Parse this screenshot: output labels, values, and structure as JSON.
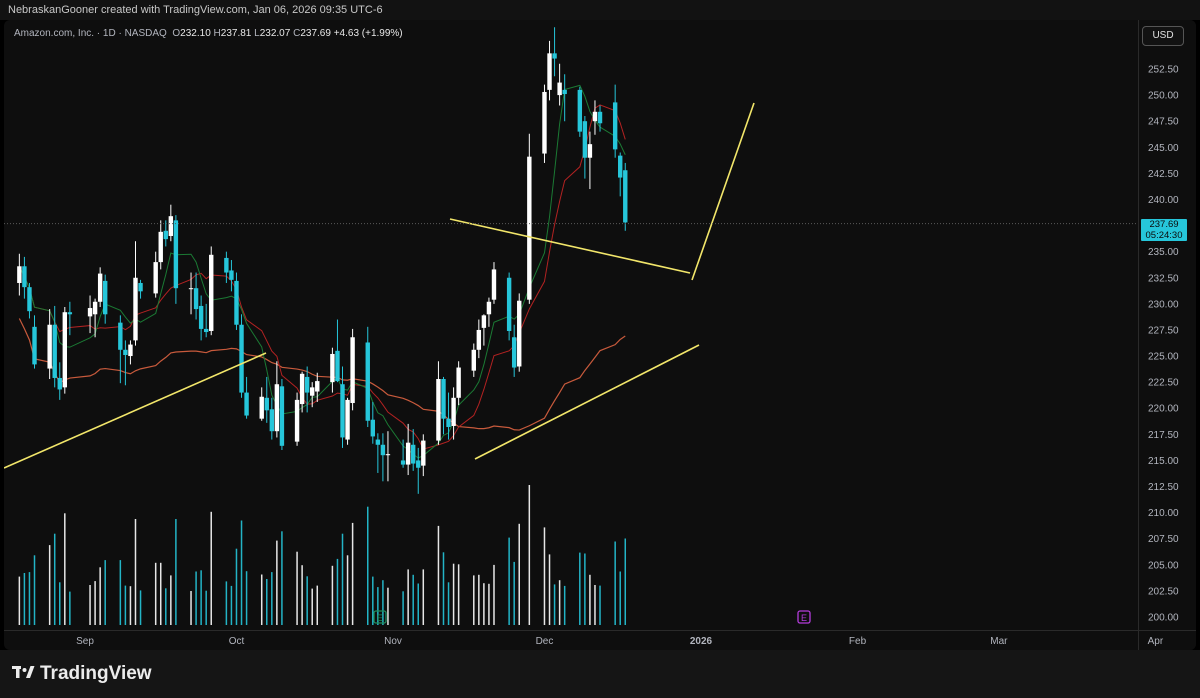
{
  "credit": "NebraskanGooner created with TradingView.com, Jan 06, 2026 09:35 UTC-6",
  "legend": {
    "symbol": "Amazon.com, Inc. · 1D · NASDAQ",
    "open_label": "O",
    "open": "232.10",
    "high_label": "H",
    "high": "237.81",
    "low_label": "L",
    "low": "232.07",
    "close_label": "C",
    "close": "237.69",
    "change": "+4.63 (+1.99%)"
  },
  "currency": "USD",
  "price_tag": {
    "price": "237.69",
    "countdown": "05:24:30"
  },
  "brand": "TradingView",
  "colors": {
    "up": "#ffffff",
    "down": "#26c6da",
    "trendline": "#f2e66a",
    "ma_long": "#c85a3c",
    "ma_mid": "#b22222",
    "ma_short": "#1b7a34",
    "earnings_marker": "#b43cdc"
  },
  "chart_data": {
    "type": "candlestick",
    "symbol": "AMZN",
    "interval": "1D",
    "y_ticks": [
      200.0,
      202.5,
      205.0,
      207.5,
      210.0,
      212.5,
      215.0,
      217.5,
      220.0,
      222.5,
      225.0,
      227.5,
      230.0,
      232.5,
      235.0,
      237.5,
      240.0,
      242.5,
      245.0,
      247.5,
      250.0,
      252.5
    ],
    "y_tick_labels": [
      "200.00",
      "202.50",
      "205.00",
      "207.50",
      "210.00",
      "212.50",
      "215.00",
      "217.50",
      "220.00",
      "222.50",
      "225.00",
      "227.50",
      "230.00",
      "232.50",
      "235.00",
      "237.50",
      "240.00",
      "242.50",
      "245.00",
      "247.50",
      "250.00",
      "252.50"
    ],
    "ylim": [
      198.5,
      255.8
    ],
    "x_labels": [
      "Sep",
      "Oct",
      "Nov",
      "Dec",
      "2026",
      "Feb",
      "Mar",
      "Apr"
    ],
    "x_label_dates": [
      "2025-09-01",
      "2025-10-01",
      "2025-11-01",
      "2025-12-01",
      "2026-01-01",
      "2026-02-01",
      "2026-03-01",
      "2026-04-01"
    ],
    "last_price": 237.69,
    "candles": [
      [
        "2025-08-19",
        232.0,
        234.8,
        230.8,
        233.6
      ],
      [
        "2025-08-20",
        233.6,
        234.5,
        230.5,
        231.6
      ],
      [
        "2025-08-21",
        231.6,
        232.0,
        228.6,
        229.3
      ],
      [
        "2025-08-22",
        227.8,
        228.9,
        223.8,
        224.2
      ],
      [
        "2025-08-25",
        223.8,
        229.5,
        222.8,
        228.0
      ],
      [
        "2025-08-26",
        228.0,
        229.8,
        222.0,
        222.9
      ],
      [
        "2025-08-27",
        222.9,
        224.4,
        220.8,
        221.8
      ],
      [
        "2025-08-28",
        222.0,
        229.7,
        221.4,
        229.2
      ],
      [
        "2025-08-29",
        229.2,
        230.2,
        227.0,
        229.0
      ],
      [
        "2025-09-02",
        228.8,
        230.8,
        227.2,
        229.6
      ],
      [
        "2025-09-03",
        229.0,
        230.5,
        226.8,
        230.2
      ],
      [
        "2025-09-04",
        230.2,
        233.5,
        229.7,
        232.9
      ],
      [
        "2025-09-05",
        232.2,
        232.8,
        228.1,
        229.0
      ],
      [
        "2025-09-08",
        228.2,
        228.9,
        222.4,
        225.6
      ],
      [
        "2025-09-09",
        225.6,
        226.5,
        222.2,
        225.1
      ],
      [
        "2025-09-10",
        225.0,
        226.5,
        224.2,
        226.1
      ],
      [
        "2025-09-11",
        226.5,
        236.0,
        226.0,
        232.5
      ],
      [
        "2025-09-12",
        232.0,
        232.3,
        230.5,
        231.2
      ],
      [
        "2025-09-15",
        231.0,
        235.0,
        230.6,
        234.0
      ],
      [
        "2025-09-16",
        234.0,
        238.0,
        233.3,
        236.9
      ],
      [
        "2025-09-17",
        237.0,
        238.0,
        235.5,
        236.2
      ],
      [
        "2025-09-18",
        236.5,
        239.5,
        236.0,
        238.4
      ],
      [
        "2025-09-19",
        238.0,
        238.5,
        230.0,
        231.5
      ],
      [
        "2025-09-22",
        231.5,
        233.0,
        229.0,
        231.5
      ],
      [
        "2025-09-23",
        231.5,
        233.0,
        228.5,
        229.5
      ],
      [
        "2025-09-24",
        229.8,
        230.8,
        226.5,
        227.6
      ],
      [
        "2025-09-25",
        227.6,
        230.0,
        226.8,
        227.3
      ],
      [
        "2025-09-26",
        227.4,
        235.5,
        227.0,
        234.7
      ],
      [
        "2025-09-29",
        234.4,
        235.0,
        232.0,
        233.0
      ],
      [
        "2025-09-30",
        233.2,
        234.2,
        231.2,
        232.3
      ],
      [
        "2025-10-01",
        232.2,
        233.0,
        227.5,
        228.0
      ],
      [
        "2025-10-02",
        228.0,
        229.0,
        221.0,
        221.5
      ],
      [
        "2025-10-03",
        221.5,
        223.0,
        219.0,
        219.3
      ],
      [
        "2025-10-06",
        219.0,
        222.0,
        218.8,
        221.1
      ],
      [
        "2025-10-07",
        221.0,
        223.0,
        218.6,
        219.8
      ],
      [
        "2025-10-08",
        219.9,
        221.0,
        217.0,
        217.8
      ],
      [
        "2025-10-09",
        217.8,
        224.5,
        217.2,
        222.3
      ],
      [
        "2025-10-10",
        222.1,
        222.8,
        216.0,
        216.4
      ],
      [
        "2025-10-13",
        216.8,
        221.5,
        216.4,
        220.8
      ],
      [
        "2025-10-14",
        220.4,
        223.5,
        219.6,
        223.3
      ],
      [
        "2025-10-15",
        223.0,
        224.0,
        219.6,
        221.5
      ],
      [
        "2025-10-16",
        221.2,
        222.5,
        220.1,
        222.0
      ],
      [
        "2025-10-17",
        221.6,
        223.4,
        220.6,
        222.6
      ],
      [
        "2025-10-20",
        222.5,
        225.8,
        221.5,
        225.2
      ],
      [
        "2025-10-21",
        225.5,
        228.5,
        222.5,
        222.6
      ],
      [
        "2025-10-22",
        222.3,
        224.0,
        216.2,
        217.2
      ],
      [
        "2025-10-23",
        217.0,
        221.0,
        216.5,
        220.8
      ],
      [
        "2025-10-24",
        220.5,
        227.6,
        219.8,
        226.8
      ],
      [
        "2025-10-27",
        226.3,
        227.8,
        218.2,
        218.8
      ],
      [
        "2025-10-28",
        218.9,
        220.6,
        216.6,
        217.3
      ],
      [
        "2025-10-29",
        217.0,
        217.6,
        213.8,
        216.5
      ],
      [
        "2025-10-30",
        216.5,
        217.6,
        213.0,
        215.5
      ],
      [
        "2025-10-31",
        215.5,
        217.8,
        213.0,
        215.6
      ],
      [
        "2025-11-03",
        215.0,
        217.0,
        214.3,
        214.6
      ],
      [
        "2025-11-04",
        214.6,
        218.5,
        213.6,
        216.7
      ],
      [
        "2025-11-05",
        216.5,
        218.0,
        214.0,
        214.7
      ],
      [
        "2025-11-06",
        215.0,
        216.2,
        211.8,
        214.3
      ],
      [
        "2025-11-07",
        214.5,
        217.5,
        213.5,
        216.9
      ],
      [
        "2025-11-10",
        216.9,
        224.5,
        216.5,
        222.8
      ],
      [
        "2025-11-11",
        222.8,
        223.0,
        217.5,
        219.0
      ],
      [
        "2025-11-12",
        219.0,
        221.5,
        217.0,
        218.2
      ],
      [
        "2025-11-13",
        218.3,
        222.0,
        217.0,
        221.0
      ],
      [
        "2025-11-14",
        221.0,
        224.5,
        220.3,
        223.9
      ],
      [
        "2025-11-17",
        223.6,
        226.2,
        223.0,
        225.6
      ],
      [
        "2025-11-18",
        225.6,
        228.5,
        224.8,
        227.5
      ],
      [
        "2025-11-19",
        227.7,
        229.0,
        226.0,
        228.9
      ],
      [
        "2025-11-20",
        229.0,
        230.6,
        227.8,
        230.2
      ],
      [
        "2025-11-21",
        230.4,
        234.0,
        230.0,
        233.3
      ],
      [
        "2025-11-24",
        232.5,
        233.0,
        226.5,
        227.4
      ],
      [
        "2025-11-25",
        226.8,
        228.0,
        223.0,
        223.9
      ],
      [
        "2025-11-26",
        224.0,
        231.0,
        223.5,
        230.3
      ],
      [
        "2025-11-28",
        230.4,
        246.3,
        230.0,
        244.1
      ],
      [
        "2025-12-01",
        244.4,
        251.0,
        243.5,
        250.3
      ],
      [
        "2025-12-02",
        250.5,
        255.2,
        249.5,
        254.0
      ],
      [
        "2025-12-03",
        254.0,
        256.5,
        251.8,
        253.5
      ],
      [
        "2025-12-04",
        250.0,
        253.0,
        249.0,
        251.2
      ],
      [
        "2025-12-05",
        250.5,
        252.0,
        247.5,
        250.1
      ],
      [
        "2025-12-08",
        250.5,
        250.8,
        246.0,
        246.5
      ],
      [
        "2025-12-09",
        247.5,
        248.0,
        242.0,
        244.0
      ],
      [
        "2025-12-10",
        244.0,
        246.5,
        241.0,
        245.3
      ],
      [
        "2025-12-11",
        247.5,
        249.5,
        246.2,
        248.4
      ],
      [
        "2025-12-12",
        248.4,
        249.0,
        246.5,
        247.3
      ],
      [
        "2025-12-15",
        249.3,
        251.0,
        244.0,
        244.8
      ],
      [
        "2025-12-16",
        244.2,
        244.5,
        240.3,
        242.1
      ],
      [
        "2025-12-17",
        242.8,
        243.5,
        237.0,
        237.8
      ]
    ]
  },
  "volume_axis_hidden": true
}
